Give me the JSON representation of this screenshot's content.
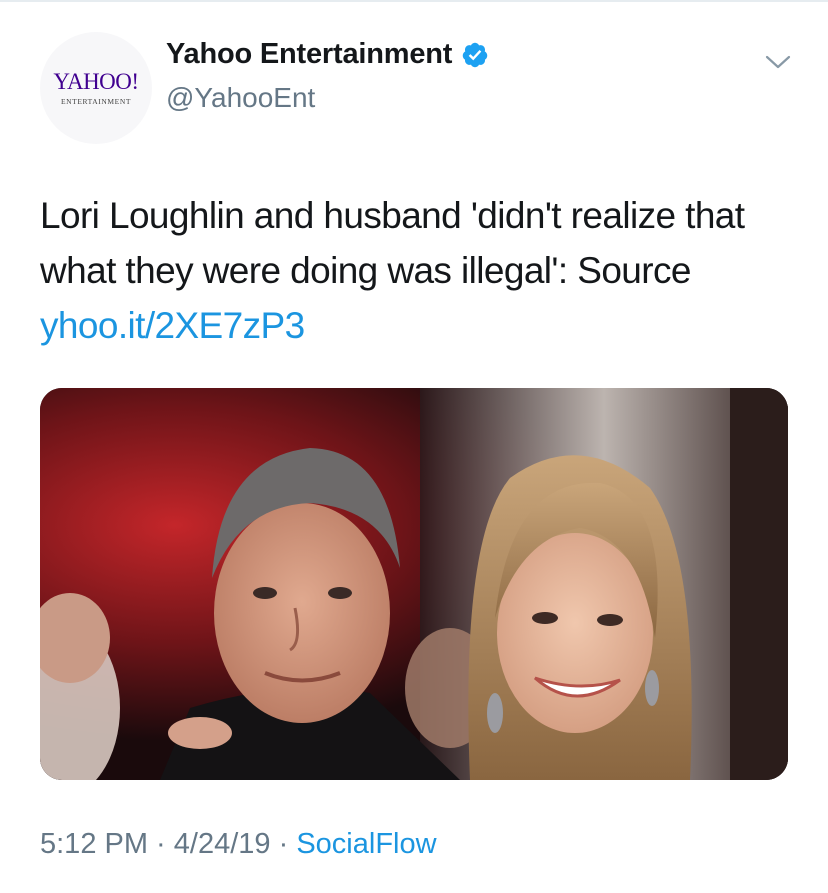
{
  "account": {
    "avatar_logo": "YAHOO!",
    "avatar_sub": "ENTERTAINMENT",
    "display_name": "Yahoo Entertainment",
    "handle": "@YahooEnt",
    "verified_icon": "verified-badge-icon",
    "menu_icon": "chevron-down-icon"
  },
  "tweet": {
    "text": "Lori Loughlin and husband 'didn't realize that what they were doing was illegal': Source ",
    "link": "yhoo.it/2XE7zP3"
  },
  "meta": {
    "time": "5:12 PM",
    "sep1": " · ",
    "date": "4/24/19",
    "sep2": " · ",
    "source": "SocialFlow"
  },
  "colors": {
    "link": "#1b95e0",
    "secondary_text": "#657786",
    "brand_purple": "#400090"
  }
}
